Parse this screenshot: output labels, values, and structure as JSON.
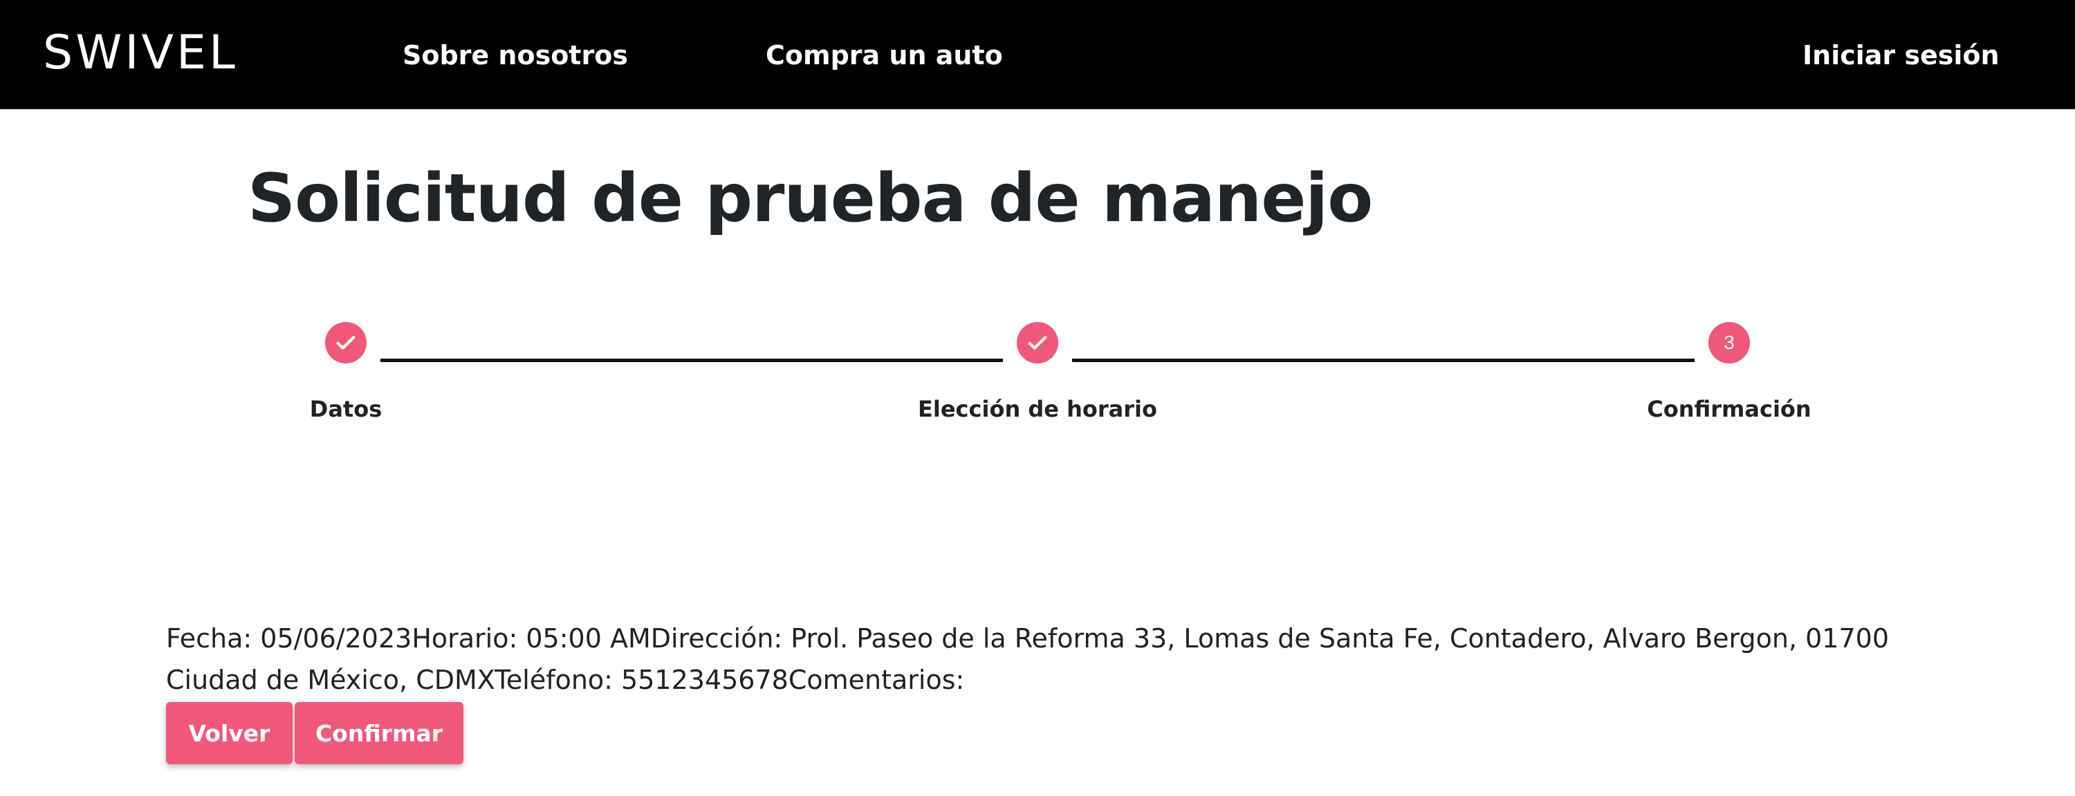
{
  "nav": {
    "logo": "SWIVEL",
    "about": "Sobre nosotros",
    "buy": "Compra un auto",
    "login": "Iniciar sesión"
  },
  "page": {
    "title": "Solicitud de prueba de manejo"
  },
  "stepper": {
    "steps": [
      {
        "label": "Datos",
        "state": "completed"
      },
      {
        "label": "Elección de horario",
        "state": "completed"
      },
      {
        "label": "Confirmación",
        "state": "active",
        "number": "3"
      }
    ]
  },
  "summary": {
    "text": "Fecha: 05/06/2023Horario: 05:00 AMDirección: Prol. Paseo de la Reforma 33, Lomas de Santa Fe, Contadero, Alvaro Bergon, 01700 Ciudad de México, CDMXTeléfono: 5512345678Comentarios:"
  },
  "actions": {
    "back": "Volver",
    "confirm": "Confirmar"
  },
  "colors": {
    "accent": "#f0587a",
    "navbar": "#000000",
    "text": "#1f2428"
  },
  "icons": {
    "completed": "check-icon"
  }
}
